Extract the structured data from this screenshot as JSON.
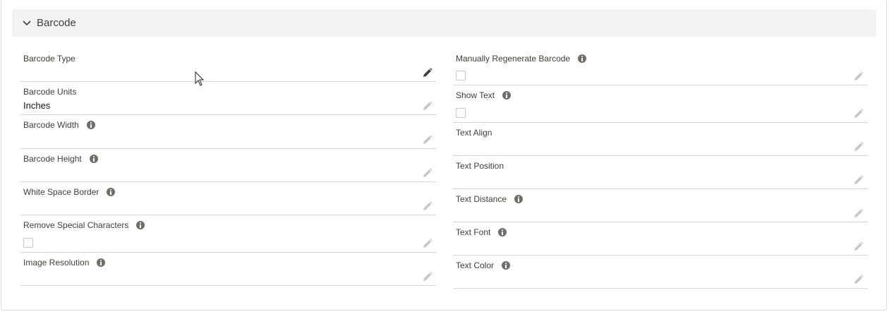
{
  "section": {
    "title": "Barcode",
    "expanded": true
  },
  "left_fields": [
    {
      "label": "Barcode Type",
      "value": "",
      "info": false,
      "checkbox": false,
      "edit_active": true
    },
    {
      "label": "Barcode Units",
      "value": "Inches",
      "info": false,
      "checkbox": false,
      "edit_active": false
    },
    {
      "label": "Barcode Width",
      "value": "",
      "info": true,
      "checkbox": false,
      "edit_active": false
    },
    {
      "label": "Barcode Height",
      "value": "",
      "info": true,
      "checkbox": false,
      "edit_active": false
    },
    {
      "label": "White Space Border",
      "value": "",
      "info": true,
      "checkbox": false,
      "edit_active": false
    },
    {
      "label": "Remove Special Characters",
      "value": "",
      "info": true,
      "checkbox": true,
      "checked": false,
      "edit_active": false
    },
    {
      "label": "Image Resolution",
      "value": "",
      "info": true,
      "checkbox": false,
      "edit_active": false
    }
  ],
  "right_fields": [
    {
      "label": "Manually Regenerate Barcode",
      "value": "",
      "info": true,
      "checkbox": true,
      "checked": false,
      "edit_active": false
    },
    {
      "label": "Show Text",
      "value": "",
      "info": true,
      "checkbox": true,
      "checked": false,
      "edit_active": false
    },
    {
      "label": "Text Align",
      "value": "",
      "info": false,
      "checkbox": false,
      "edit_active": false
    },
    {
      "label": "Text Position",
      "value": "",
      "info": false,
      "checkbox": false,
      "edit_active": false
    },
    {
      "label": "Text Distance",
      "value": "",
      "info": true,
      "checkbox": false,
      "edit_active": false
    },
    {
      "label": "Text Font",
      "value": "",
      "info": true,
      "checkbox": false,
      "edit_active": false
    },
    {
      "label": "Text Color",
      "value": "",
      "info": true,
      "checkbox": false,
      "edit_active": false
    }
  ],
  "icons": {
    "collapse": "chevron-down-icon",
    "info": "info-icon",
    "edit": "pencil-icon",
    "cursor": "mouse-pointer-icon"
  },
  "colors": {
    "header_bg": "#f3f3f3",
    "edit_active": "#3e3e3c",
    "edit_inactive": "#c9c7c5",
    "info_icon": "#706e6b"
  }
}
